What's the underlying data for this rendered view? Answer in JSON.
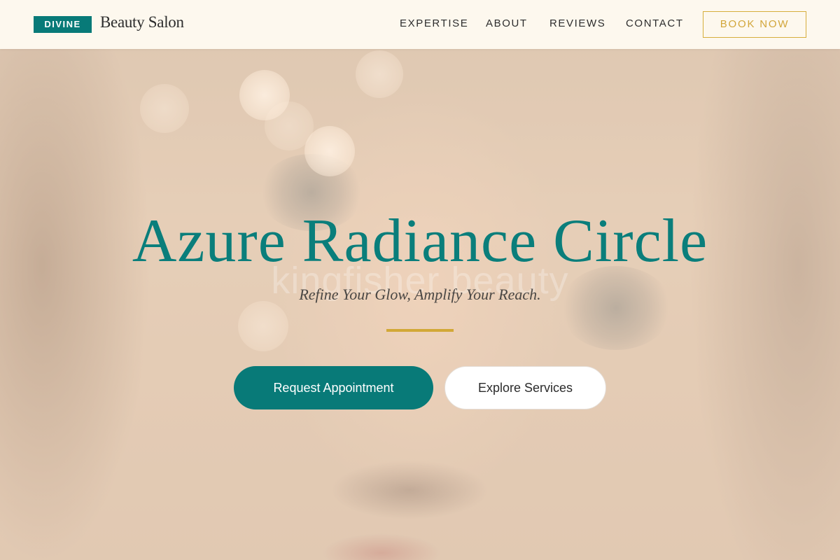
{
  "header": {
    "brand_badge": "DIVINE",
    "brand_name": "Beauty Salon",
    "nav": [
      {
        "label": "EXPERTISE"
      },
      {
        "label": "ABOUT"
      },
      {
        "label": "REVIEWS"
      },
      {
        "label": "CONTACT"
      }
    ],
    "cta_label": "BOOK NOW"
  },
  "hero": {
    "title": "Azure Radiance Circle",
    "watermark": "kingfisher beauty",
    "subtitle": "Refine Your Glow, Amplify Your Reach.",
    "primary_button": "Request Appointment",
    "secondary_button": "Explore Services",
    "background_image": "portrait-face-photo"
  },
  "colors": {
    "accent_teal": "#087a78",
    "accent_gold": "#d2a837",
    "header_bg": "#fdf8ee"
  }
}
